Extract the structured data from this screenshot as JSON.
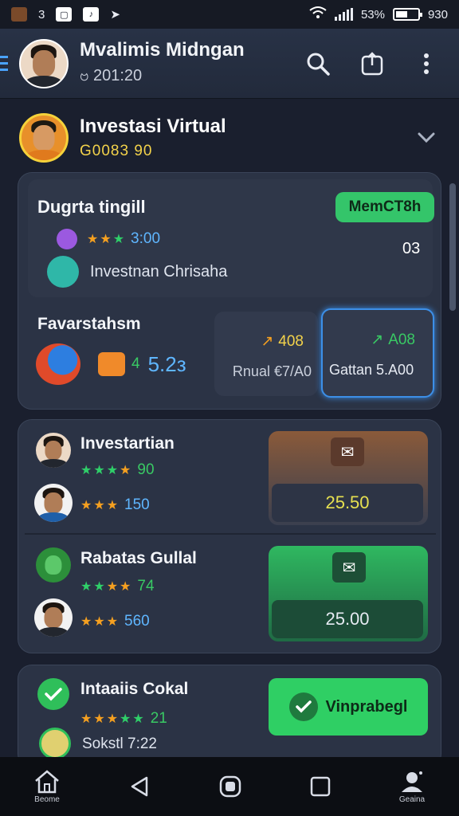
{
  "statusbar": {
    "left_icons": [
      "app-icon",
      "3",
      "image-icon",
      "tiktok-icon",
      "arrow-icon"
    ],
    "badge_3": "3",
    "battery_pct": "53%",
    "time": "930"
  },
  "appbar": {
    "name": "Mvalimis Midngan",
    "sub": "ဗ 201:20"
  },
  "section": {
    "title": "Investasi Virtual",
    "sub": "G0083 90"
  },
  "card1": {
    "title": "Dugrta tingill",
    "button": "MemCT8h",
    "stars_value": "3:00",
    "side_value": "03",
    "item_label": "Investnan Chrisaha",
    "fav_title": "Favarstahsm",
    "fav_value": "5.2з",
    "fav_prefix": "4",
    "box_a": {
      "top": "408",
      "bottom": "Rnual €7/Α0"
    },
    "box_b": {
      "top": "A08",
      "bottom": "Gattan 5.A00"
    }
  },
  "card2": {
    "row1_title": "Investartian",
    "row1_star1": "90",
    "row1_star2": "150",
    "row1_value": "25.50",
    "row2_title": "Rabatas Gullal",
    "row2_star1": "74",
    "row2_star2": "560",
    "row2_value": "25.00"
  },
  "card3": {
    "title": "Intaaiis Cokal",
    "stars_value": "21",
    "sub": "Sokstl 7:22",
    "button": "Vinprabegl"
  },
  "nav": {
    "home_label": "Beome",
    "profile_label": "Geaina"
  },
  "colors": {
    "accent_green": "#34c56a",
    "accent_blue": "#4aa3ff",
    "star_orange": "#f5a020",
    "gold": "#f3d24a"
  }
}
